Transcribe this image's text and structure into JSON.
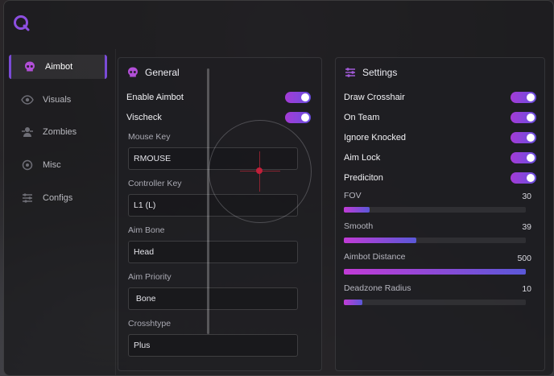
{
  "sidebar": {
    "items": [
      {
        "label": "Aimbot",
        "icon": "skull-icon",
        "active": true
      },
      {
        "label": "Visuals",
        "icon": "eye-icon",
        "active": false
      },
      {
        "label": "Zombies",
        "icon": "zombie-icon",
        "active": false
      },
      {
        "label": "Misc",
        "icon": "sliders-icon",
        "active": false
      },
      {
        "label": "Configs",
        "icon": "settings-list-icon",
        "active": false
      }
    ]
  },
  "general": {
    "title": "General",
    "toggles": [
      {
        "label": "Enable Aimbot",
        "on": true
      },
      {
        "label": "Vischeck",
        "on": true
      }
    ],
    "fields": [
      {
        "label": "Mouse Key",
        "value": "RMOUSE"
      },
      {
        "label": "Controller Key",
        "value": "L1 (L)"
      },
      {
        "label": "Aim Bone",
        "value": "Head"
      },
      {
        "label": "Aim Priority",
        "value": " Bone"
      },
      {
        "label": "Crosshtype",
        "value": "Plus"
      }
    ]
  },
  "settings": {
    "title": "Settings",
    "toggles": [
      {
        "label": "Draw Crosshair",
        "on": true
      },
      {
        "label": "On Team",
        "on": true
      },
      {
        "label": "Ignore Knocked",
        "on": true
      },
      {
        "label": "Aim Lock",
        "on": true
      },
      {
        "label": "Prediciton",
        "on": true
      }
    ],
    "sliders": [
      {
        "label": "FOV",
        "value": "30",
        "fraction": 0.14
      },
      {
        "label": "Smooth",
        "value": "39",
        "fraction": 0.4
      },
      {
        "label": "Aimbot Distance",
        "value": "500",
        "fraction": 1.0
      },
      {
        "label": "Deadzone Radius",
        "value": "10",
        "fraction": 0.1
      }
    ]
  },
  "colors": {
    "accent": "#7a4bd6",
    "toggle_start": "#a43bd6",
    "toggle_end": "#6a4fe0"
  }
}
